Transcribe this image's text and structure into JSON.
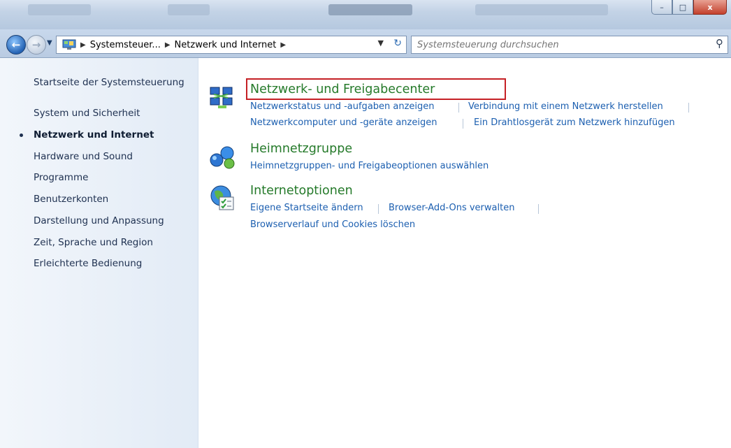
{
  "window": {
    "minimize_label": "–",
    "maximize_label": "□",
    "close_label": "x"
  },
  "navigation": {
    "breadcrumb": [
      "Systemsteuer...",
      "Netzwerk und Internet"
    ],
    "search_placeholder": "Systemsteuerung durchsuchen"
  },
  "sidebar": {
    "items": [
      {
        "label": "Startseite der Systemsteuerung",
        "active": false
      },
      {
        "label": "System und Sicherheit",
        "active": false
      },
      {
        "label": "Netzwerk und Internet",
        "active": true
      },
      {
        "label": "Hardware und Sound",
        "active": false
      },
      {
        "label": "Programme",
        "active": false
      },
      {
        "label": "Benutzerkonten",
        "active": false
      },
      {
        "label": "Darstellung und Anpassung",
        "active": false
      },
      {
        "label": "Zeit, Sprache und Region",
        "active": false
      },
      {
        "label": "Erleichterte Bedienung",
        "active": false
      }
    ]
  },
  "categories": [
    {
      "title": "Netzwerk- und Freigabecenter",
      "icon": "network-center-icon",
      "highlighted": true,
      "links": [
        "Netzwerkstatus und -aufgaben anzeigen",
        "Verbindung mit einem Netzwerk herstellen",
        "Netzwerkcomputer und -geräte anzeigen",
        "Ein Drahtlosgerät zum Netzwerk hinzufügen"
      ]
    },
    {
      "title": "Heimnetzgruppe",
      "icon": "homegroup-icon",
      "links": [
        "Heimnetzgruppen- und Freigabeoptionen auswählen"
      ]
    },
    {
      "title": "Internetoptionen",
      "icon": "internet-options-icon",
      "links": [
        "Eigene Startseite ändern",
        "Browser-Add-Ons verwalten",
        "Browserverlauf und Cookies löschen"
      ]
    }
  ],
  "colors": {
    "category_title": "#257a2a",
    "link": "#1c5fb0",
    "highlight_box": "#c52025",
    "sidebar_text": "#1e3050"
  }
}
